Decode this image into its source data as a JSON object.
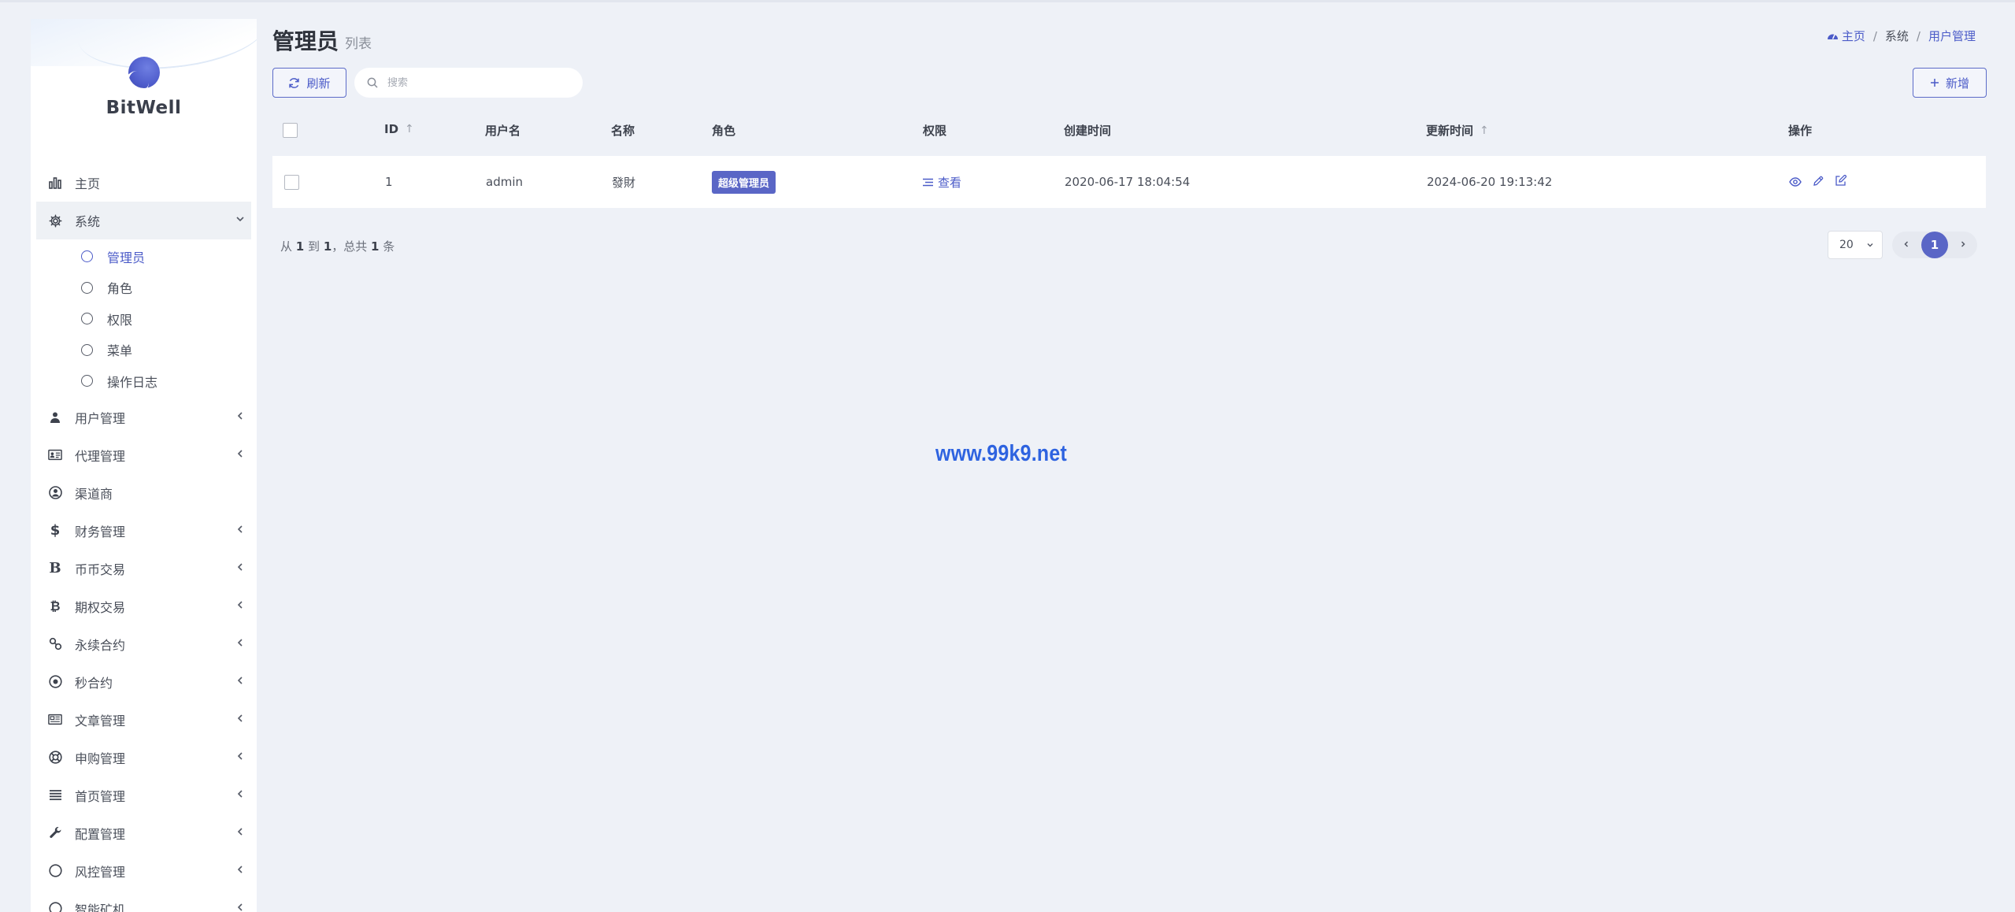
{
  "brand": {
    "name": "BitWell"
  },
  "sidebar": {
    "items": [
      {
        "label": "主页",
        "icon": "bar-chart-icon",
        "glyph": "📊"
      },
      {
        "label": "系统",
        "icon": "gear-icon",
        "glyph": "⚙",
        "expanded": true,
        "children": [
          {
            "label": "管理员",
            "active": true
          },
          {
            "label": "角色"
          },
          {
            "label": "权限"
          },
          {
            "label": "菜单"
          },
          {
            "label": "操作日志"
          }
        ]
      },
      {
        "label": "用户管理",
        "icon": "user-icon",
        "glyph": "👤"
      },
      {
        "label": "代理管理",
        "icon": "id-card-icon",
        "glyph": "🪪"
      },
      {
        "label": "渠道商",
        "icon": "user-circle-icon",
        "glyph": "◉"
      },
      {
        "label": "财务管理",
        "icon": "dollar-icon",
        "glyph": "$"
      },
      {
        "label": "币币交易",
        "icon": "bitcoin-icon",
        "glyph": "B"
      },
      {
        "label": "期权交易",
        "icon": "btc-icon",
        "glyph": "₿"
      },
      {
        "label": "永续合约",
        "icon": "link-icon",
        "glyph": "🔗"
      },
      {
        "label": "秒合约",
        "icon": "dot-circle-icon",
        "glyph": "⊙"
      },
      {
        "label": "文章管理",
        "icon": "newspaper-icon",
        "glyph": "📰"
      },
      {
        "label": "申购管理",
        "icon": "lifebuoy-icon",
        "glyph": "❂"
      },
      {
        "label": "首页管理",
        "icon": "bars-icon",
        "glyph": "☰"
      },
      {
        "label": "配置管理",
        "icon": "wrench-icon",
        "glyph": "🔧"
      },
      {
        "label": "风控管理",
        "icon": "circle-icon",
        "glyph": "○"
      },
      {
        "label": "智能矿机",
        "icon": "circle-icon",
        "glyph": "○"
      }
    ]
  },
  "header": {
    "title": "管理员",
    "subtitle": "列表",
    "breadcrumb": [
      "主页",
      "系统",
      "用户管理"
    ]
  },
  "toolbar": {
    "refresh_label": "刷新",
    "search_placeholder": "搜索",
    "add_label": "新增"
  },
  "table": {
    "columns": [
      "ID",
      "用户名",
      "名称",
      "角色",
      "权限",
      "创建时间",
      "更新时间",
      "操作"
    ],
    "rows": [
      {
        "id": "1",
        "username": "admin",
        "name": "發財",
        "role": "超级管理员",
        "permission": "查看",
        "created_at": "2020-06-17 18:04:54",
        "updated_at": "2024-06-20 19:13:42"
      }
    ]
  },
  "pagination": {
    "summary_from": "从",
    "from": "1",
    "summary_to": "到",
    "to": "1",
    "summary_total": "，总共",
    "total": "1",
    "summary_unit": "条",
    "per_page": "20",
    "current_page": "1"
  },
  "watermark": "www.99k9.net",
  "colors": {
    "accent": "#5a66c6",
    "link": "#4b5bc8",
    "background": "#eef1f7"
  }
}
